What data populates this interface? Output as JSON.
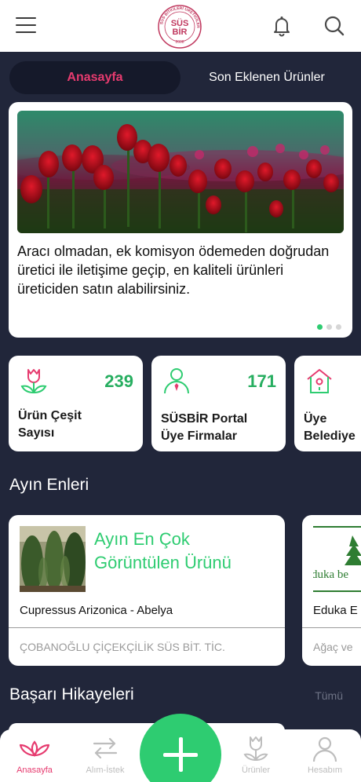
{
  "header": {
    "logo_text_top": "SÜS BİTKİLERİ ÜRETİCİLERİ BİRLİĞİ",
    "logo_letters": "SÜS BİR",
    "logo_year": "2008",
    "icons": [
      "menu-icon",
      "bell-icon",
      "search-icon"
    ]
  },
  "segment": {
    "active_label": "Anasayfa",
    "inactive_label": "Son Eklenen Ürünler"
  },
  "hero": {
    "text": "Aracı olmadan, ek komisyon ödemeden doğrudan üretici ile iletişime geçip, en kaliteli ürünleri üreticiden satın alabilirsiniz.",
    "page_count": 3,
    "active_page": 1
  },
  "stats": [
    {
      "value": "239",
      "label_line1": "Ürün Çeşit",
      "label_line2": "Sayısı",
      "icon": "tulip-icon"
    },
    {
      "value": "171",
      "label_line1": "SÜSBİR Portal",
      "label_line2": "Üye Firmalar",
      "icon": "member-icon"
    },
    {
      "value": "",
      "label_line1": "Üye",
      "label_line2": "Belediye",
      "icon": "birdhouse-icon"
    }
  ],
  "sections": {
    "month_best": "Ayın Enleri",
    "success_stories": "Başarı Hikayeleri",
    "all_link": "Tümü"
  },
  "products": [
    {
      "headline_line1": "Ayın En Çok",
      "headline_line2": "Görüntülen Ürünü",
      "name": "Cupressus Arizonica - Abelya",
      "firm": "ÇOBANOĞLU ÇİÇEKÇİLİK SÜS BİT. TİC."
    },
    {
      "logo_text": "duka be",
      "name": "Eduka E",
      "firm": "Ağaç ve"
    }
  ],
  "tabbar": {
    "tabs": [
      {
        "label": "Anasayfa",
        "active": true
      },
      {
        "label": "Alım-İstek",
        "active": false
      },
      {
        "label": "Ürünler",
        "active": false
      },
      {
        "label": "Hesabım",
        "active": false
      }
    ]
  },
  "colors": {
    "background": "#21263a",
    "accent_pink": "#e63b6f",
    "accent_green": "#2ecc71",
    "card": "#ffffff"
  }
}
